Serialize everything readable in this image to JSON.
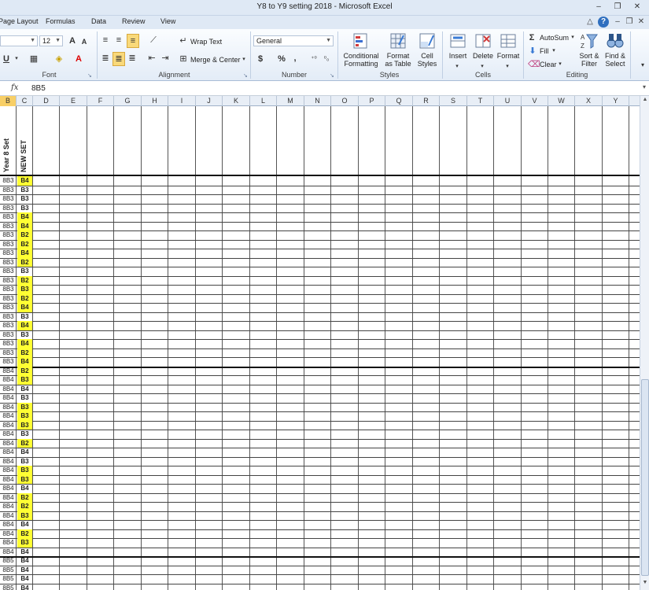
{
  "window": {
    "title": "Y8 to Y9 setting 2018  -  Microsoft Excel",
    "minimize": "–",
    "restore": "❐",
    "close": "✕"
  },
  "tabs": [
    "Page Layout",
    "Formulas",
    "Data",
    "Review",
    "View"
  ],
  "tab_controls": {
    "collapse": "△",
    "help": "?",
    "min": "–",
    "restore": "❐",
    "close": "✕"
  },
  "ribbon": {
    "font": {
      "label": "Font",
      "size": "12",
      "grow": "A",
      "shrink": "A",
      "underline": "U"
    },
    "alignment": {
      "label": "Alignment",
      "wrap_text": "Wrap Text",
      "merge_center": "Merge & Center"
    },
    "number": {
      "label": "Number",
      "format": "General",
      "currency": "$",
      "percent": "%",
      "comma": ","
    },
    "styles": {
      "label": "Styles",
      "conditional": "Conditional Formatting",
      "conditional_l1": "Conditional",
      "conditional_l2": "Formatting",
      "format_table_l1": "Format",
      "format_table_l2": "as Table",
      "cell_styles_l1": "Cell",
      "cell_styles_l2": "Styles"
    },
    "cells": {
      "label": "Cells",
      "insert": "Insert",
      "delete": "Delete",
      "format": "Format"
    },
    "editing": {
      "label": "Editing",
      "autosum": "AutoSum",
      "fill": "Fill",
      "clear": "Clear",
      "sort_l1": "Sort &",
      "sort_l2": "Filter",
      "find_l1": "Find &",
      "find_l2": "Select"
    }
  },
  "formula_bar": {
    "fx": "fx",
    "value": "8B5"
  },
  "columns": [
    "B",
    "C",
    "D",
    "E",
    "F",
    "G",
    "H",
    "I",
    "J",
    "K",
    "L",
    "M",
    "N",
    "O",
    "P",
    "Q",
    "R",
    "S",
    "T",
    "U",
    "V",
    "W",
    "X",
    "Y"
  ],
  "header_row": {
    "col_b": "Year 8 Set",
    "col_c": "NEW SET"
  },
  "rows": [
    {
      "b": "8B3",
      "c": "B4",
      "hl": true
    },
    {
      "b": "8B3",
      "c": "B3",
      "hl": false
    },
    {
      "b": "8B3",
      "c": "B3",
      "hl": false
    },
    {
      "b": "8B3",
      "c": "B3",
      "hl": false
    },
    {
      "b": "8B3",
      "c": "B4",
      "hl": true
    },
    {
      "b": "8B3",
      "c": "B4",
      "hl": true
    },
    {
      "b": "8B3",
      "c": "B2",
      "hl": true
    },
    {
      "b": "8B3",
      "c": "B2",
      "hl": true
    },
    {
      "b": "8B3",
      "c": "B4",
      "hl": true
    },
    {
      "b": "8B3",
      "c": "B2",
      "hl": true
    },
    {
      "b": "8B3",
      "c": "B3",
      "hl": false
    },
    {
      "b": "8B3",
      "c": "B2",
      "hl": true
    },
    {
      "b": "8B3",
      "c": "B3",
      "hl": true
    },
    {
      "b": "8B3",
      "c": "B2",
      "hl": true
    },
    {
      "b": "8B3",
      "c": "B4",
      "hl": true
    },
    {
      "b": "8B3",
      "c": "B3",
      "hl": false
    },
    {
      "b": "8B3",
      "c": "B4",
      "hl": true
    },
    {
      "b": "8B3",
      "c": "B3",
      "hl": false
    },
    {
      "b": "8B3",
      "c": "B4",
      "hl": true
    },
    {
      "b": "8B3",
      "c": "B2",
      "hl": true
    },
    {
      "b": "8B3",
      "c": "B4",
      "hl": true
    },
    {
      "b": "8B4",
      "c": "B2",
      "hl": true
    },
    {
      "b": "8B4",
      "c": "B3",
      "hl": true
    },
    {
      "b": "8B4",
      "c": "B4",
      "hl": false
    },
    {
      "b": "8B4",
      "c": "B3",
      "hl": false
    },
    {
      "b": "8B4",
      "c": "B3",
      "hl": true
    },
    {
      "b": "8B4",
      "c": "B3",
      "hl": true
    },
    {
      "b": "8B4",
      "c": "B3",
      "hl": true
    },
    {
      "b": "8B4",
      "c": "B3",
      "hl": false
    },
    {
      "b": "8B4",
      "c": "B2",
      "hl": true
    },
    {
      "b": "8B4",
      "c": "B4",
      "hl": false
    },
    {
      "b": "8B4",
      "c": "B3",
      "hl": false
    },
    {
      "b": "8B4",
      "c": "B3",
      "hl": true
    },
    {
      "b": "8B4",
      "c": "B3",
      "hl": true
    },
    {
      "b": "8B4",
      "c": "B4",
      "hl": false
    },
    {
      "b": "8B4",
      "c": "B2",
      "hl": true
    },
    {
      "b": "8B4",
      "c": "B2",
      "hl": true
    },
    {
      "b": "8B4",
      "c": "B3",
      "hl": true
    },
    {
      "b": "8B4",
      "c": "B4",
      "hl": false
    },
    {
      "b": "8B4",
      "c": "B2",
      "hl": true
    },
    {
      "b": "8B4",
      "c": "B3",
      "hl": true
    },
    {
      "b": "8B4",
      "c": "B4",
      "hl": false
    },
    {
      "b": "8B5",
      "c": "B4",
      "hl": false
    },
    {
      "b": "8B5",
      "c": "B4",
      "hl": false
    },
    {
      "b": "8B5",
      "c": "B4",
      "hl": false
    },
    {
      "b": "8B5",
      "c": "B4",
      "hl": false
    }
  ],
  "colors": {
    "yellow_fill": "#ffff33",
    "selected_header": "#f8cf66"
  }
}
